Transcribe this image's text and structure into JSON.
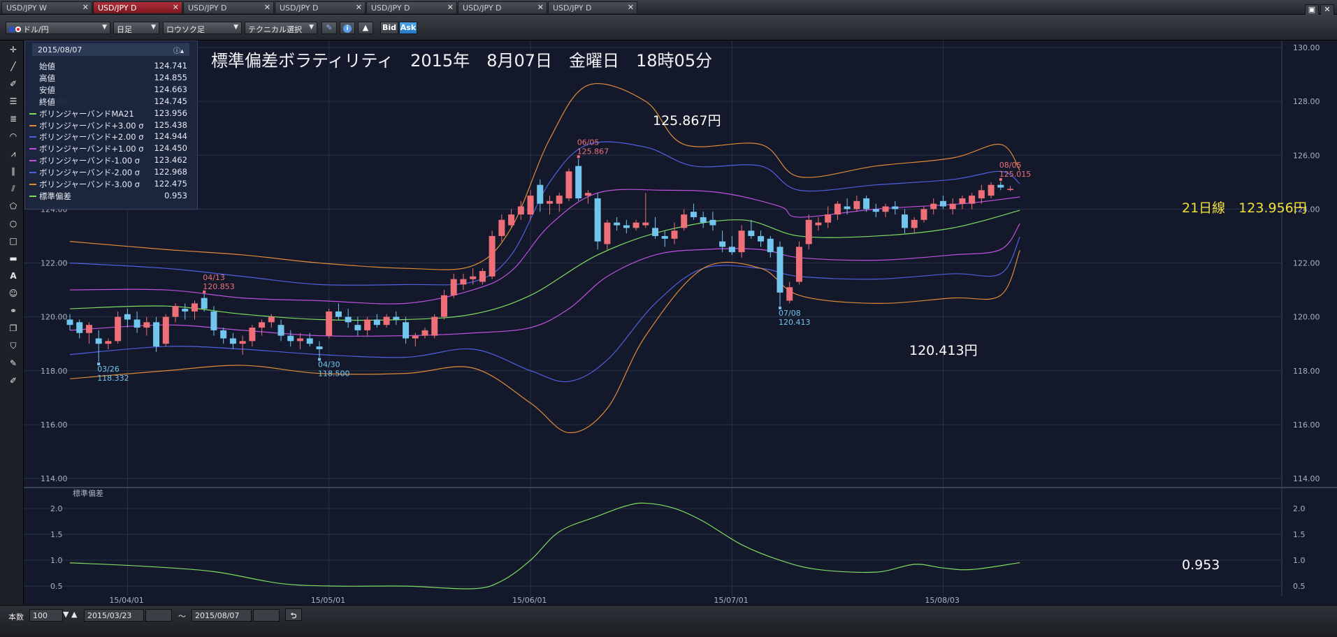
{
  "tabs": [
    {
      "label": "USD/JPY W",
      "active": false
    },
    {
      "label": "USD/JPY D",
      "active": true
    },
    {
      "label": "USD/JPY D",
      "active": false
    },
    {
      "label": "USD/JPY D",
      "active": false
    },
    {
      "label": "USD/JPY D",
      "active": false
    },
    {
      "label": "USD/JPY D",
      "active": false
    },
    {
      "label": "USD/JPY D",
      "active": false
    }
  ],
  "toolbar": {
    "currency_pair": "ドル/円",
    "period": "日足",
    "chart_type": "ロウソク足",
    "technical_select": "テクニカル選択",
    "bid_label": "Bid",
    "ask_label": "Ask"
  },
  "info_panel": {
    "date": "2015/08/07",
    "rows": [
      {
        "label": "始値",
        "value": "124.741",
        "color": ""
      },
      {
        "label": "高値",
        "value": "124.855",
        "color": ""
      },
      {
        "label": "安値",
        "value": "124.663",
        "color": ""
      },
      {
        "label": "終値",
        "value": "124.745",
        "color": ""
      },
      {
        "label": "ボリンジャーバンドMA21",
        "value": "123.956",
        "color": "#7fdc60"
      },
      {
        "label": "ボリンジャーバンド+3.00 σ",
        "value": "125.438",
        "color": "#e08a3a"
      },
      {
        "label": "ボリンジャーバンド+2.00 σ",
        "value": "124.944",
        "color": "#5060e0"
      },
      {
        "label": "ボリンジャーバンド+1.00 σ",
        "value": "124.450",
        "color": "#c050e0"
      },
      {
        "label": "ボリンジャーバンド-1.00 σ",
        "value": "123.462",
        "color": "#c050e0"
      },
      {
        "label": "ボリンジャーバンド-2.00 σ",
        "value": "122.968",
        "color": "#5060e0"
      },
      {
        "label": "ボリンジャーバンド-3.00 σ",
        "value": "122.475",
        "color": "#e08a3a"
      },
      {
        "label": "標準偏差",
        "value": "0.953",
        "color": "#7fdc60"
      }
    ]
  },
  "annotations": {
    "title": "標準偏差ボラティリティ　2015年　8月07日　金曜日　18時05分",
    "high_big": "125.867円",
    "low_big": "120.413円",
    "ma_label": "21日線　123.956円",
    "sd_value": "0.953"
  },
  "colors": {
    "up": "#ef6f78",
    "down": "#72c6ee",
    "ma": "#7fdc60",
    "s1": "#c050e0",
    "s2": "#5060e0",
    "s3": "#e08a3a"
  },
  "chart_data": {
    "type": "candlestick",
    "price_axis": {
      "min": 114.0,
      "max": 130.0,
      "ticks": [
        "130.00",
        "128.00",
        "126.00",
        "124.00",
        "122.00",
        "120.00",
        "118.00",
        "116.00",
        "114.00"
      ]
    },
    "sd_axis": {
      "min": 0.3,
      "max": 2.2,
      "ticks": [
        "2.0",
        "1.5",
        "1.0",
        "0.5"
      ]
    },
    "x_ticks": [
      "15/04/01",
      "15/05/01",
      "15/06/01",
      "15/07/01",
      "15/08/03"
    ],
    "x_tick_index": [
      6,
      27,
      48,
      69,
      91
    ],
    "sd_title": "標準偏差",
    "price_labels": [
      {
        "date": "03/26",
        "value": "118.332",
        "i": 3,
        "type": "low"
      },
      {
        "date": "04/13",
        "value": "120.853",
        "i": 14,
        "type": "high"
      },
      {
        "date": "04/30",
        "value": "118.500",
        "i": 26,
        "type": "low"
      },
      {
        "date": "06/05",
        "value": "125.867",
        "i": 53,
        "type": "high"
      },
      {
        "date": "07/08",
        "value": "120.413",
        "i": 74,
        "type": "low"
      },
      {
        "date": "08/05",
        "value": "125.015",
        "i": 97,
        "type": "high"
      }
    ],
    "ohlc": [
      [
        119.9,
        120.1,
        119.5,
        119.7
      ],
      [
        119.8,
        119.9,
        119.2,
        119.4
      ],
      [
        119.4,
        119.8,
        119.0,
        119.7
      ],
      [
        119.2,
        119.5,
        118.33,
        119.0
      ],
      [
        119.0,
        119.2,
        118.8,
        119.1
      ],
      [
        119.1,
        120.2,
        119.0,
        120.0
      ],
      [
        120.1,
        120.3,
        119.6,
        119.9
      ],
      [
        119.9,
        120.2,
        119.4,
        119.6
      ],
      [
        119.6,
        120.0,
        119.3,
        119.8
      ],
      [
        119.8,
        120.0,
        118.7,
        118.9
      ],
      [
        119.0,
        120.1,
        118.9,
        120.0
      ],
      [
        120.0,
        120.5,
        119.8,
        120.4
      ],
      [
        120.3,
        120.5,
        119.9,
        120.2
      ],
      [
        120.2,
        120.6,
        119.9,
        120.5
      ],
      [
        120.7,
        120.85,
        120.2,
        120.3
      ],
      [
        120.2,
        120.4,
        119.3,
        119.5
      ],
      [
        119.5,
        119.6,
        119.0,
        119.2
      ],
      [
        119.2,
        119.4,
        118.8,
        119.0
      ],
      [
        119.0,
        119.3,
        118.6,
        119.1
      ],
      [
        119.1,
        119.7,
        118.9,
        119.6
      ],
      [
        119.6,
        119.9,
        119.3,
        119.8
      ],
      [
        119.8,
        120.1,
        119.6,
        120.0
      ],
      [
        119.7,
        119.9,
        119.1,
        119.3
      ],
      [
        119.3,
        119.5,
        118.9,
        119.1
      ],
      [
        119.1,
        119.4,
        118.8,
        119.2
      ],
      [
        119.2,
        119.4,
        118.9,
        119.0
      ],
      [
        118.9,
        119.1,
        118.5,
        118.8
      ],
      [
        119.3,
        120.3,
        119.2,
        120.2
      ],
      [
        120.2,
        120.5,
        119.9,
        120.0
      ],
      [
        120.0,
        120.3,
        119.6,
        119.8
      ],
      [
        119.7,
        120.0,
        119.3,
        119.5
      ],
      [
        119.5,
        120.0,
        119.3,
        119.9
      ],
      [
        119.9,
        120.1,
        119.6,
        119.7
      ],
      [
        119.7,
        120.1,
        119.6,
        120.0
      ],
      [
        120.0,
        120.2,
        119.7,
        119.9
      ],
      [
        119.8,
        120.0,
        119.0,
        119.2
      ],
      [
        119.2,
        119.4,
        118.9,
        119.3
      ],
      [
        119.3,
        119.6,
        119.2,
        119.5
      ],
      [
        119.3,
        120.1,
        119.2,
        120.0
      ],
      [
        120.0,
        121.0,
        119.9,
        120.8
      ],
      [
        120.8,
        121.6,
        120.7,
        121.4
      ],
      [
        121.2,
        121.6,
        121.0,
        121.4
      ],
      [
        121.4,
        121.8,
        121.2,
        121.5
      ],
      [
        121.3,
        121.8,
        121.2,
        121.7
      ],
      [
        121.5,
        123.2,
        121.4,
        123.0
      ],
      [
        123.0,
        123.8,
        122.8,
        123.6
      ],
      [
        123.4,
        124.0,
        123.3,
        123.8
      ],
      [
        123.8,
        124.3,
        123.6,
        124.1
      ],
      [
        123.8,
        124.7,
        123.6,
        124.5
      ],
      [
        124.9,
        125.1,
        123.9,
        124.2
      ],
      [
        124.2,
        124.5,
        123.8,
        124.3
      ],
      [
        124.2,
        124.6,
        123.9,
        124.5
      ],
      [
        124.4,
        125.5,
        124.3,
        125.4
      ],
      [
        125.6,
        125.87,
        124.3,
        124.4
      ],
      [
        124.5,
        124.7,
        124.2,
        124.6
      ],
      [
        124.4,
        124.6,
        122.5,
        122.8
      ],
      [
        122.7,
        123.6,
        122.5,
        123.5
      ],
      [
        123.5,
        123.7,
        123.2,
        123.4
      ],
      [
        123.4,
        123.6,
        123.1,
        123.3
      ],
      [
        123.3,
        123.6,
        123.2,
        123.5
      ],
      [
        123.4,
        124.6,
        123.3,
        123.5
      ],
      [
        123.3,
        123.7,
        122.9,
        123.0
      ],
      [
        123.0,
        123.2,
        122.6,
        122.9
      ],
      [
        122.9,
        123.5,
        122.7,
        123.2
      ],
      [
        123.3,
        124.0,
        123.2,
        123.8
      ],
      [
        123.9,
        124.2,
        123.6,
        123.7
      ],
      [
        123.7,
        123.9,
        123.3,
        123.5
      ],
      [
        123.6,
        123.9,
        123.2,
        123.4
      ],
      [
        122.8,
        123.2,
        122.4,
        122.6
      ],
      [
        122.6,
        123.0,
        122.3,
        122.4
      ],
      [
        122.4,
        123.4,
        122.2,
        123.2
      ],
      [
        123.2,
        123.6,
        122.9,
        123.0
      ],
      [
        123.0,
        123.2,
        122.6,
        122.8
      ],
      [
        122.9,
        123.0,
        122.2,
        122.4
      ],
      [
        122.6,
        122.8,
        120.41,
        120.9
      ],
      [
        120.6,
        121.3,
        120.5,
        121.1
      ],
      [
        121.3,
        122.8,
        121.2,
        122.6
      ],
      [
        122.7,
        123.8,
        122.5,
        123.6
      ],
      [
        123.4,
        123.7,
        123.2,
        123.5
      ],
      [
        123.5,
        124.1,
        123.3,
        123.8
      ],
      [
        123.8,
        124.3,
        123.6,
        124.2
      ],
      [
        124.1,
        124.4,
        123.8,
        124.0
      ],
      [
        124.0,
        124.5,
        123.9,
        124.3
      ],
      [
        124.4,
        124.5,
        123.9,
        124.0
      ],
      [
        124.0,
        124.2,
        123.7,
        123.9
      ],
      [
        123.9,
        124.2,
        123.7,
        124.1
      ],
      [
        124.1,
        124.3,
        123.8,
        124.0
      ],
      [
        123.8,
        124.0,
        123.1,
        123.3
      ],
      [
        123.3,
        123.7,
        123.1,
        123.6
      ],
      [
        123.6,
        124.1,
        123.5,
        124.0
      ],
      [
        124.0,
        124.4,
        123.8,
        124.2
      ],
      [
        124.3,
        124.5,
        124.0,
        124.1
      ],
      [
        124.0,
        124.4,
        123.8,
        124.2
      ],
      [
        124.2,
        124.5,
        124.0,
        124.4
      ],
      [
        124.2,
        124.6,
        124.0,
        124.5
      ],
      [
        124.4,
        124.9,
        124.2,
        124.7
      ],
      [
        124.5,
        125.0,
        124.4,
        124.9
      ],
      [
        124.9,
        125.02,
        124.7,
        124.8
      ],
      [
        124.74,
        124.86,
        124.66,
        124.75
      ]
    ],
    "bands": {
      "ma": [
        [
          0,
          120.3
        ],
        [
          10,
          120.4
        ],
        [
          18,
          120.1
        ],
        [
          26,
          119.9
        ],
        [
          35,
          119.9
        ],
        [
          42,
          120.1
        ],
        [
          48,
          120.8
        ],
        [
          55,
          122.3
        ],
        [
          62,
          123.2
        ],
        [
          70,
          123.6
        ],
        [
          76,
          123.0
        ],
        [
          84,
          123.0
        ],
        [
          92,
          123.3
        ],
        [
          99,
          123.956
        ]
      ],
      "p1": [
        [
          0,
          121.0
        ],
        [
          10,
          121.0
        ],
        [
          18,
          120.7
        ],
        [
          26,
          120.6
        ],
        [
          35,
          120.5
        ],
        [
          42,
          121.0
        ],
        [
          46,
          121.7
        ],
        [
          50,
          123.4
        ],
        [
          55,
          124.6
        ],
        [
          62,
          124.7
        ],
        [
          68,
          124.6
        ],
        [
          74,
          124.1
        ],
        [
          76,
          123.7
        ],
        [
          84,
          124.0
        ],
        [
          93,
          124.2
        ],
        [
          99,
          124.45
        ]
      ],
      "m1": [
        [
          0,
          119.5
        ],
        [
          10,
          119.7
        ],
        [
          18,
          119.5
        ],
        [
          26,
          119.3
        ],
        [
          35,
          119.3
        ],
        [
          42,
          119.4
        ],
        [
          48,
          119.6
        ],
        [
          52,
          120.3
        ],
        [
          56,
          121.5
        ],
        [
          61,
          122.3
        ],
        [
          66,
          122.5
        ],
        [
          72,
          122.5
        ],
        [
          76,
          122.2
        ],
        [
          84,
          122.1
        ],
        [
          92,
          122.3
        ],
        [
          97,
          122.5
        ],
        [
          99,
          123.462
        ]
      ],
      "p2": [
        [
          0,
          122.0
        ],
        [
          10,
          121.8
        ],
        [
          18,
          121.5
        ],
        [
          26,
          121.2
        ],
        [
          35,
          121.2
        ],
        [
          42,
          121.3
        ],
        [
          46,
          122.3
        ],
        [
          50,
          125.0
        ],
        [
          54,
          126.4
        ],
        [
          60,
          126.3
        ],
        [
          65,
          125.6
        ],
        [
          72,
          125.6
        ],
        [
          76,
          124.7
        ],
        [
          84,
          124.9
        ],
        [
          92,
          125.1
        ],
        [
          97,
          125.4
        ],
        [
          99,
          124.944
        ]
      ],
      "m2": [
        [
          0,
          118.6
        ],
        [
          10,
          118.9
        ],
        [
          18,
          118.8
        ],
        [
          26,
          118.6
        ],
        [
          35,
          118.5
        ],
        [
          42,
          118.8
        ],
        [
          48,
          118.0
        ],
        [
          52,
          117.6
        ],
        [
          56,
          118.4
        ],
        [
          61,
          120.5
        ],
        [
          66,
          121.8
        ],
        [
          72,
          121.8
        ],
        [
          76,
          121.5
        ],
        [
          84,
          121.4
        ],
        [
          92,
          121.6
        ],
        [
          97,
          121.6
        ],
        [
          99,
          122.968
        ]
      ],
      "p3": [
        [
          0,
          122.8
        ],
        [
          10,
          122.5
        ],
        [
          18,
          122.3
        ],
        [
          26,
          122.0
        ],
        [
          35,
          121.8
        ],
        [
          42,
          121.9
        ],
        [
          46,
          123.3
        ],
        [
          50,
          126.6
        ],
        [
          54,
          128.6
        ],
        [
          60,
          128.0
        ],
        [
          64,
          126.4
        ],
        [
          72,
          126.4
        ],
        [
          76,
          125.2
        ],
        [
          84,
          125.6
        ],
        [
          92,
          125.9
        ],
        [
          97,
          126.4
        ],
        [
          99,
          125.438
        ]
      ],
      "m3": [
        [
          0,
          117.7
        ],
        [
          10,
          118.0
        ],
        [
          18,
          118.2
        ],
        [
          26,
          117.9
        ],
        [
          35,
          117.9
        ],
        [
          42,
          118.1
        ],
        [
          48,
          116.8
        ],
        [
          52,
          115.7
        ],
        [
          56,
          116.6
        ],
        [
          60,
          119.3
        ],
        [
          66,
          121.8
        ],
        [
          72,
          121.8
        ],
        [
          76,
          120.8
        ],
        [
          84,
          120.5
        ],
        [
          92,
          120.7
        ],
        [
          97,
          120.8
        ],
        [
          99,
          122.475
        ]
      ]
    },
    "sd": [
      [
        0,
        0.95
      ],
      [
        8,
        0.88
      ],
      [
        15,
        0.78
      ],
      [
        22,
        0.55
      ],
      [
        28,
        0.5
      ],
      [
        35,
        0.5
      ],
      [
        42,
        0.45
      ],
      [
        45,
        0.6
      ],
      [
        48,
        1.0
      ],
      [
        51,
        1.55
      ],
      [
        55,
        1.85
      ],
      [
        58,
        2.05
      ],
      [
        60,
        2.1
      ],
      [
        63,
        2.0
      ],
      [
        66,
        1.75
      ],
      [
        70,
        1.3
      ],
      [
        74,
        1.0
      ],
      [
        78,
        0.82
      ],
      [
        84,
        0.77
      ],
      [
        88,
        0.92
      ],
      [
        91,
        0.85
      ],
      [
        94,
        0.82
      ],
      [
        99,
        0.953
      ]
    ]
  }
}
